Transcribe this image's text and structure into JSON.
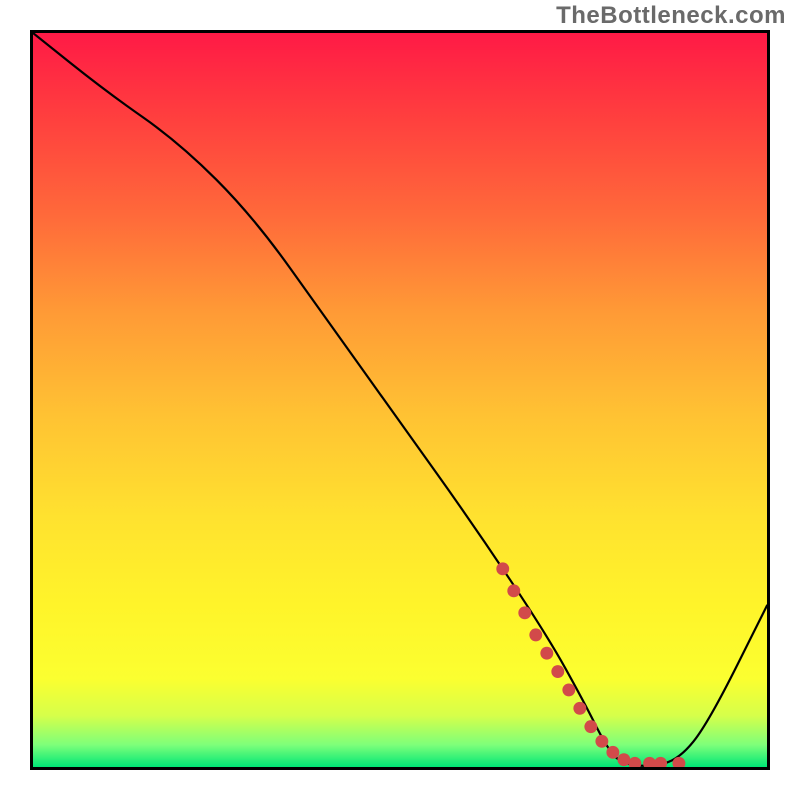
{
  "watermark": {
    "text": "TheBottleneck.com"
  },
  "chart_data": {
    "type": "line",
    "title": "",
    "xlabel": "",
    "ylabel": "",
    "xlim": [
      0,
      100
    ],
    "ylim": [
      0,
      100
    ],
    "grid": false,
    "legend": false,
    "series": [
      {
        "name": "curve",
        "color": "#000000",
        "x": [
          0,
          10,
          20,
          30,
          40,
          50,
          60,
          70,
          75,
          78,
          80,
          84,
          88,
          92,
          100
        ],
        "values": [
          100,
          92,
          85,
          75,
          61,
          47,
          33,
          18,
          9,
          3,
          0.5,
          0,
          1,
          6,
          22
        ]
      }
    ],
    "markers": {
      "name": "highlight-dots",
      "color": "#d24a4a",
      "points": [
        {
          "x": 64,
          "y": 27
        },
        {
          "x": 65.5,
          "y": 24
        },
        {
          "x": 67,
          "y": 21
        },
        {
          "x": 68.5,
          "y": 18
        },
        {
          "x": 70,
          "y": 15.5
        },
        {
          "x": 71.5,
          "y": 13
        },
        {
          "x": 73,
          "y": 10.5
        },
        {
          "x": 74.5,
          "y": 8
        },
        {
          "x": 76,
          "y": 5.5
        },
        {
          "x": 77.5,
          "y": 3.5
        },
        {
          "x": 79,
          "y": 2
        },
        {
          "x": 80.5,
          "y": 1
        },
        {
          "x": 82,
          "y": 0.5
        },
        {
          "x": 84,
          "y": 0.5
        },
        {
          "x": 85.5,
          "y": 0.5
        },
        {
          "x": 88,
          "y": 0.5
        }
      ]
    },
    "background": {
      "type": "vertical-gradient",
      "stops": [
        {
          "pos": 0.0,
          "color": "#ff1a46"
        },
        {
          "pos": 0.1,
          "color": "#ff3a3f"
        },
        {
          "pos": 0.25,
          "color": "#ff6a3a"
        },
        {
          "pos": 0.38,
          "color": "#ff9a36"
        },
        {
          "pos": 0.52,
          "color": "#ffc233"
        },
        {
          "pos": 0.66,
          "color": "#ffe22f"
        },
        {
          "pos": 0.78,
          "color": "#fff42a"
        },
        {
          "pos": 0.88,
          "color": "#fbff30"
        },
        {
          "pos": 0.93,
          "color": "#d6ff4a"
        },
        {
          "pos": 0.97,
          "color": "#7dff7a"
        },
        {
          "pos": 1.0,
          "color": "#00e676"
        }
      ]
    }
  }
}
